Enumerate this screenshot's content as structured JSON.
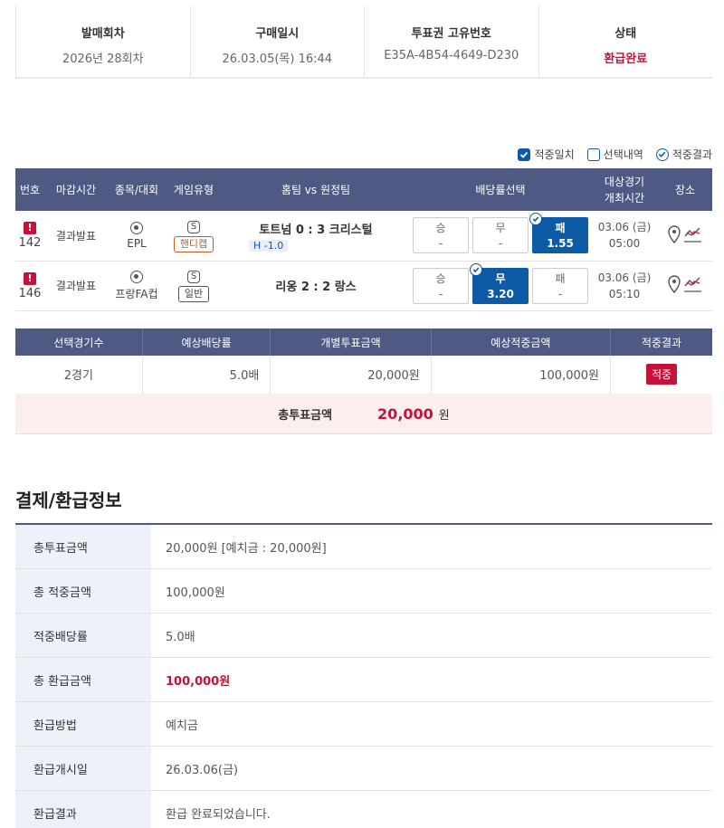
{
  "summary": [
    {
      "label": "발매회차",
      "value": "2026년 28회차"
    },
    {
      "label": "구매일시",
      "value": "26.03.05(목) 16:44"
    },
    {
      "label": "투표권 고유번호",
      "value": "E35A-4B54-4649-D230"
    },
    {
      "label": "상태",
      "value": "환급완료"
    }
  ],
  "legend": [
    "적중일치",
    "선택내역",
    "적중결과"
  ],
  "game_headers": [
    "번호",
    "마감시간",
    "종목/대회",
    "게임유형",
    "홈팀 vs 원정팀",
    "배당률선택",
    "대상경기\n개최시간",
    "장소"
  ],
  "games": [
    {
      "warn": "!",
      "number": "142",
      "deadline": "결과발표",
      "league": "EPL",
      "sport_badge": "S",
      "game_type": "핸디캡",
      "home": "토트넘",
      "home_score": "0",
      "sep": ":",
      "away_score": "3",
      "away": "크리스털",
      "handicap": "H -1.0",
      "odds": [
        {
          "label": "승",
          "value": "-"
        },
        {
          "label": "무",
          "value": "-"
        },
        {
          "label": "패",
          "value": "1.55"
        }
      ],
      "date": "03.06 (금)",
      "time": "05:00"
    },
    {
      "warn": "!",
      "number": "146",
      "deadline": "결과발표",
      "league": "프랑FA컵",
      "sport_badge": "S",
      "game_type": "일반",
      "home": "리옹",
      "home_score": "2",
      "sep": ":",
      "away_score": "2",
      "away": "랑스",
      "handicap": "",
      "odds": [
        {
          "label": "승",
          "value": "-"
        },
        {
          "label": "무",
          "value": "3.20"
        },
        {
          "label": "패",
          "value": "-"
        }
      ],
      "date": "03.06 (금)",
      "time": "05:10"
    }
  ],
  "result_headers": [
    "선택경기수",
    "예상배당률",
    "개별투표금액",
    "예상적중금액",
    "적중결과"
  ],
  "result_row": {
    "count": "2경기",
    "odds": "5.0배",
    "bet": "20,000원",
    "expected": "100,000원",
    "result": "적중"
  },
  "total": {
    "label": "총투표금액",
    "value": "20,000",
    "unit": "원"
  },
  "section_title": "결제/환급정보",
  "info": [
    {
      "k": "총투표금액",
      "v": "20,000원 [예치금 : 20,000원]"
    },
    {
      "k": "총 적중금액",
      "v": "100,000원"
    },
    {
      "k": "적중배당률",
      "v": "5.0배"
    },
    {
      "k": "총 환급금액",
      "v": "100,000원"
    },
    {
      "k": "환급방법",
      "v": "예치금"
    },
    {
      "k": "환급개시일",
      "v": "26.03.06(금)"
    },
    {
      "k": "환급결과",
      "v": "환급 완료되었습니다."
    }
  ],
  "colors": {
    "header": "#4e5a84",
    "accent_blue": "#0d5aa7",
    "accent_red": "#c4123a",
    "total_bg": "#fbeeee",
    "info_key_bg": "#eef1f9"
  },
  "icons": [
    "check-icon",
    "warning-icon",
    "soccer-ball-icon",
    "location-pin-icon",
    "chart-icon"
  ]
}
